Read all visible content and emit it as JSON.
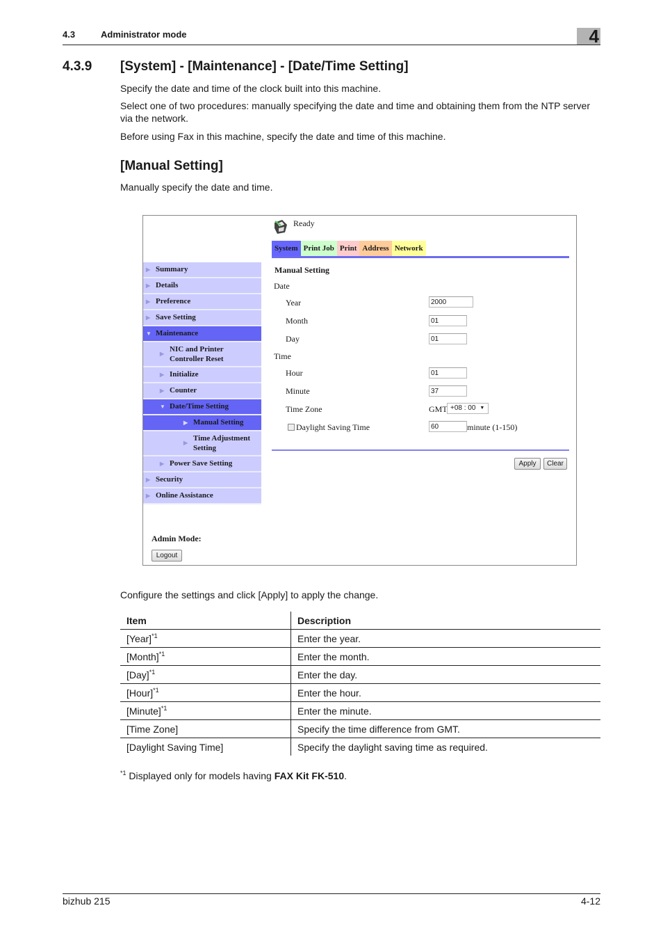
{
  "header": {
    "section_number": "4.3",
    "section_title": "Administrator mode",
    "chapter": "4"
  },
  "section": {
    "number": "4.3.9",
    "title": "[System] - [Maintenance] - [Date/Time Setting]",
    "paragraphs": [
      "Specify the date and time of the clock built into this machine.",
      "Select one of two procedures: manually specifying the date and time and obtaining them from the NTP server via the network.",
      "Before using Fax in this machine, specify the date and time of this machine."
    ]
  },
  "subsection": {
    "title": "[Manual Setting]",
    "intro": "Manually specify the date and time."
  },
  "screenshot": {
    "status": "Ready",
    "tabs": [
      {
        "label": "System",
        "color": "#6666ff"
      },
      {
        "label": "Print Job",
        "color": "#ccffcc"
      },
      {
        "label": "Print",
        "color": "#ffcccc"
      },
      {
        "label": "Address",
        "color": "#ffcc99"
      },
      {
        "label": "Network",
        "color": "#ffff99"
      }
    ],
    "sidebar": [
      {
        "label": "Summary",
        "level": 0,
        "expanded": false,
        "active": false
      },
      {
        "label": "Details",
        "level": 0,
        "expanded": false,
        "active": false
      },
      {
        "label": "Preference",
        "level": 0,
        "expanded": false,
        "active": false
      },
      {
        "label": "Save Setting",
        "level": 0,
        "expanded": false,
        "active": false
      },
      {
        "label": "Maintenance",
        "level": 0,
        "expanded": true,
        "active": true
      },
      {
        "label": "NIC and Printer Controller Reset",
        "level": 1,
        "expanded": false,
        "active": false
      },
      {
        "label": "Initialize",
        "level": 1,
        "expanded": false,
        "active": false
      },
      {
        "label": "Counter",
        "level": 1,
        "expanded": false,
        "active": false
      },
      {
        "label": "Date/Time Setting",
        "level": 1,
        "expanded": true,
        "active": true
      },
      {
        "label": "Manual Setting",
        "level": 2,
        "expanded": false,
        "active": true
      },
      {
        "label": "Time Adjustment Setting",
        "level": 2,
        "expanded": false,
        "active": false
      },
      {
        "label": "Power Save Setting",
        "level": 1,
        "expanded": false,
        "active": false
      },
      {
        "label": "Security",
        "level": 0,
        "expanded": false,
        "active": false
      },
      {
        "label": "Online Assistance",
        "level": 0,
        "expanded": false,
        "active": false
      }
    ],
    "admin_mode_label": "Admin Mode:",
    "logout_label": "Logout",
    "form": {
      "title": "Manual Setting",
      "date_group": "Date",
      "time_group": "Time",
      "year_label": "Year",
      "year_value": "2000",
      "month_label": "Month",
      "month_value": "01",
      "day_label": "Day",
      "day_value": "01",
      "hour_label": "Hour",
      "hour_value": "01",
      "minute_label": "Minute",
      "minute_value": "37",
      "timezone_label": "Time Zone",
      "timezone_prefix": "GMT",
      "timezone_value": "+08 :  00",
      "dst_label": "Daylight Saving Time",
      "dst_checked": false,
      "dst_value": "60",
      "dst_unit": "minute (1-150)",
      "apply_label": "Apply",
      "clear_label": "Clear"
    }
  },
  "instruction": "Configure the settings and click [Apply] to apply the change.",
  "table": {
    "headers": [
      "Item",
      "Description"
    ],
    "rows": [
      {
        "item": "[Year]",
        "note": "*1",
        "description": "Enter the year."
      },
      {
        "item": "[Month]",
        "note": "*1",
        "description": "Enter the month."
      },
      {
        "item": "[Day]",
        "note": "*1",
        "description": "Enter the day."
      },
      {
        "item": "[Hour]",
        "note": "*1",
        "description": "Enter the hour."
      },
      {
        "item": "[Minute]",
        "note": "*1",
        "description": "Enter the minute."
      },
      {
        "item": "[Time Zone]",
        "note": "",
        "description": "Specify the time difference from GMT."
      },
      {
        "item": "[Daylight Saving Time]",
        "note": "",
        "description": "Specify the daylight saving time as required."
      }
    ]
  },
  "footnote": {
    "marker": "*1",
    "text": " Displayed only for models having ",
    "bold": "FAX Kit FK-510",
    "end": "."
  },
  "footer": {
    "product": "bizhub 215",
    "page": "4-12"
  }
}
